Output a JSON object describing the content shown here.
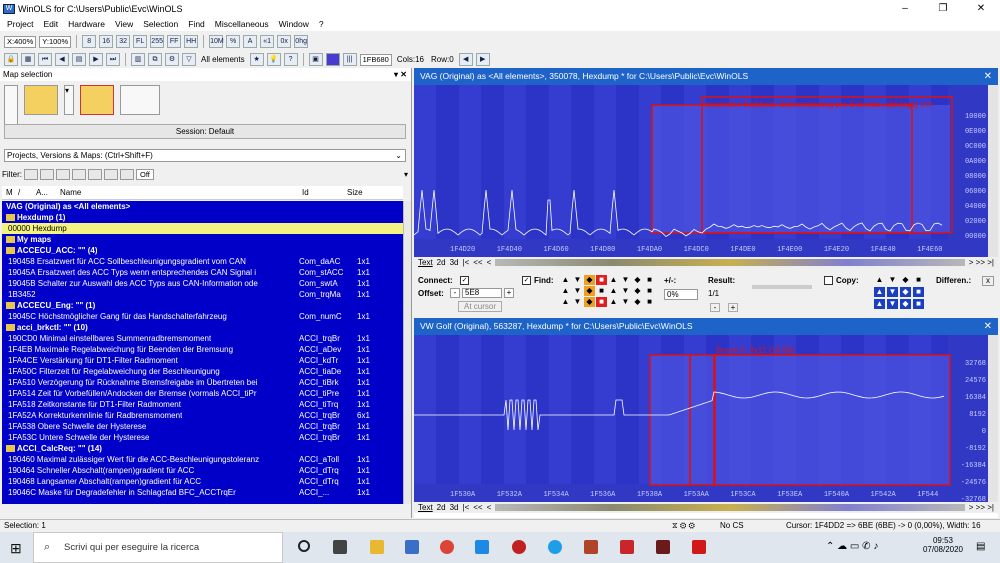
{
  "window": {
    "title": "WinOLS for C:\\Users\\Public\\Evc\\WinOLS",
    "app_icon": "WinOLS-icon",
    "controls": [
      "–",
      "❐",
      "✕"
    ]
  },
  "menu": [
    "Project",
    "Edit",
    "Hardware",
    "View",
    "Selection",
    "Find",
    "Miscellaneous",
    "Window",
    "?"
  ],
  "toolbar1": {
    "zoom_x": "X:400%",
    "zoom_y": "Y:100%",
    "labels": [
      "8",
      "16",
      "32",
      "FL",
      "255",
      "FF",
      "HH",
      "10M",
      "%",
      "A",
      "«1",
      "0x",
      "0hg"
    ]
  },
  "toolbar2": {
    "elements_label": "All elements",
    "address": "1FB680",
    "cols": "Cols:16",
    "row": "Row:0"
  },
  "map_selection": {
    "title": "Map selection",
    "session": "Session: Default",
    "projects_select": "Projects, Versions & Maps: (Ctrl+Shift+F)",
    "filter_label": "Filter:",
    "filter_off": "Off",
    "columns": [
      "M",
      "/",
      "A...",
      "Name",
      "Id",
      "Size"
    ],
    "rows": [
      {
        "type": "grp",
        "name": "VAG (Original) as <All elements>",
        "id": "",
        "size": ""
      },
      {
        "type": "grp",
        "name": "Hexdump (1)",
        "id": "",
        "size": "",
        "folder": true
      },
      {
        "type": "sel",
        "name": "00000   Hexdump",
        "id": "",
        "size": ""
      },
      {
        "type": "grp",
        "name": "My maps",
        "id": "",
        "size": "",
        "folder": true
      },
      {
        "type": "grp",
        "name": "ACCECU_ACC: \"\" (4)",
        "id": "",
        "size": "",
        "folder": true
      },
      {
        "type": "row",
        "name": "190458   Ersatzwert für ACC Sollbeschleunigungsgradient vom CAN",
        "id": "Com_daAC",
        "size": "1x1"
      },
      {
        "type": "row",
        "name": "19045A   Ersatzwert des ACC Typs wenn entsprechendes CAN Signal i",
        "id": "Com_stACC",
        "size": "1x1"
      },
      {
        "type": "row",
        "name": "19045B   Schalter zur Auswahl des ACC Typs aus CAN-Information ode",
        "id": "Com_swtA",
        "size": "1x1"
      },
      {
        "type": "row",
        "name": "1B3452",
        "id": "Com_trqMa",
        "size": "1x1"
      },
      {
        "type": "grp",
        "name": "ACCECU_Eng: \"\" (1)",
        "id": "",
        "size": "",
        "folder": true
      },
      {
        "type": "row",
        "name": "19045C   Höchstmöglicher Gang für das Handschalterfahrzeug",
        "id": "Com_numC",
        "size": "1x1"
      },
      {
        "type": "grp",
        "name": "acci_brkctl: \"\" (10)",
        "id": "",
        "size": "",
        "folder": true
      },
      {
        "type": "row",
        "name": "190CD0   Minimal einstellbares Summenradbremsmoment",
        "id": "ACCI_trqBr",
        "size": "1x1"
      },
      {
        "type": "row",
        "name": "1F4EB    Maximale Regelabweichung für Beenden der Bremsung",
        "id": "ACCI_aDev",
        "size": "1x1"
      },
      {
        "type": "row",
        "name": "1FA4CE   Verstärkung für DT1-Filter Radmoment",
        "id": "ACCI_kdTr",
        "size": "1x1"
      },
      {
        "type": "row",
        "name": "1FA50C   Filterzeit für Regelabweichung der Beschleunigung",
        "id": "ACCI_tiaDe",
        "size": "1x1"
      },
      {
        "type": "row",
        "name": "1FA510   Verzögerung für Rücknahme Bremsfreigabe im Übertreten bei",
        "id": "ACCI_tiBrk",
        "size": "1x1"
      },
      {
        "type": "row",
        "name": "1FA514   Zeit für Vorbefüllen/Andocken der Bremse (vormals ACCI_tiPr",
        "id": "ACCI_tiPre",
        "size": "1x1"
      },
      {
        "type": "row",
        "name": "1FA518   Zeitkonstante für DT1-Filter Radmoment",
        "id": "ACCI_tiTrq",
        "size": "1x1"
      },
      {
        "type": "row",
        "name": "1FA52A   Korrekturkennlinie für Radbremsmoment",
        "id": "ACCI_trqBr",
        "size": "6x1"
      },
      {
        "type": "row",
        "name": "1FA538   Obere Schwelle der Hysterese",
        "id": "ACCI_trqBr",
        "size": "1x1"
      },
      {
        "type": "row",
        "name": "1FA53C   Untere Schwelle der Hysterese",
        "id": "ACCI_trqBr",
        "size": "1x1"
      },
      {
        "type": "grp",
        "name": "ACCI_CalcReq: \"\" (14)",
        "id": "",
        "size": "",
        "folder": true
      },
      {
        "type": "row",
        "name": "190460   Maximal zulässiger Wert für die ACC-Beschleunigungstoleranz",
        "id": "ACCI_aToll",
        "size": "1x1"
      },
      {
        "type": "row",
        "name": "190464   Schneller Abschalt(rampen)gradient für ACC",
        "id": "ACCI_dTrq",
        "size": "1x1"
      },
      {
        "type": "row",
        "name": "190468   Langsamer Abschalt(rampen)gradient für ACC",
        "id": "ACCI_dTrq",
        "size": "1x1"
      },
      {
        "type": "row",
        "name": "19046C   Maske für Degradefehler in Schlagcfad BFC_ACCTrqEr",
        "id": "ACCI_...",
        "size": "1x1"
      }
    ]
  },
  "win1": {
    "title": "VAG (Original) as <All elements>, 350078, Hexdump * for C:\\Users\\Public\\Evc\\WinOLS",
    "map_label": "maximaler Raildruck-Sollwertanstieg pro Sekunde, abhängig von",
    "x_ticks": [
      "1F4D20",
      "1F4D40",
      "1F4D60",
      "1F4D80",
      "1F4DA0",
      "1F4DC0",
      "1F4DE0",
      "1F4E00",
      "1F4E20",
      "1F4E40",
      "1F4E60"
    ],
    "y_ticks": [
      "10000",
      "0E000",
      "0C000",
      "0A000",
      "08000",
      "06000",
      "04000",
      "02000",
      "00000"
    ],
    "tabs": [
      "Text",
      "2d",
      "3d"
    ],
    "nav": [
      "|<",
      "<<",
      "<"
    ]
  },
  "panel": {
    "connect": "Connect:",
    "offset": "Offset:",
    "offset_value": "5E8",
    "at_cursor": "At cursor",
    "find": "Find:",
    "plusminus": "+/-:",
    "percent": "0%",
    "result": "Result:",
    "result_value": "1/1",
    "copy": "Copy:",
    "differences": "Differen.:"
  },
  "win2": {
    "title": "VW Golf (Original), 563287, Hexdump * for C:\\Users\\Public\\Evc\\WinOLS",
    "map_label": "Bosch II: 8x12 (16 Bit)",
    "x_ticks": [
      "1F530A",
      "1F532A",
      "1F534A",
      "1F536A",
      "1F538A",
      "1F53AA",
      "1F53CA",
      "1F53EA",
      "1F540A",
      "1F542A",
      "1F544"
    ],
    "y_ticks": [
      "32768",
      "24576",
      "16384",
      "8192",
      "0",
      "-8192",
      "-16384",
      "-24576",
      "-32768"
    ],
    "tabs": [
      "Text",
      "2d",
      "3d"
    ],
    "nav": [
      "|<",
      "<<",
      "<"
    ]
  },
  "status": {
    "selection": "Selection: 1",
    "mid": "No CS",
    "cursor": "Cursor: 1F4DD2 => 6BE (6BE) -> 0 (0,00%), Width: 16"
  },
  "taskbar": {
    "search_placeholder": "Scrivi qui per eseguire la ricerca",
    "time": "09:53",
    "date": "07/08/2020"
  }
}
